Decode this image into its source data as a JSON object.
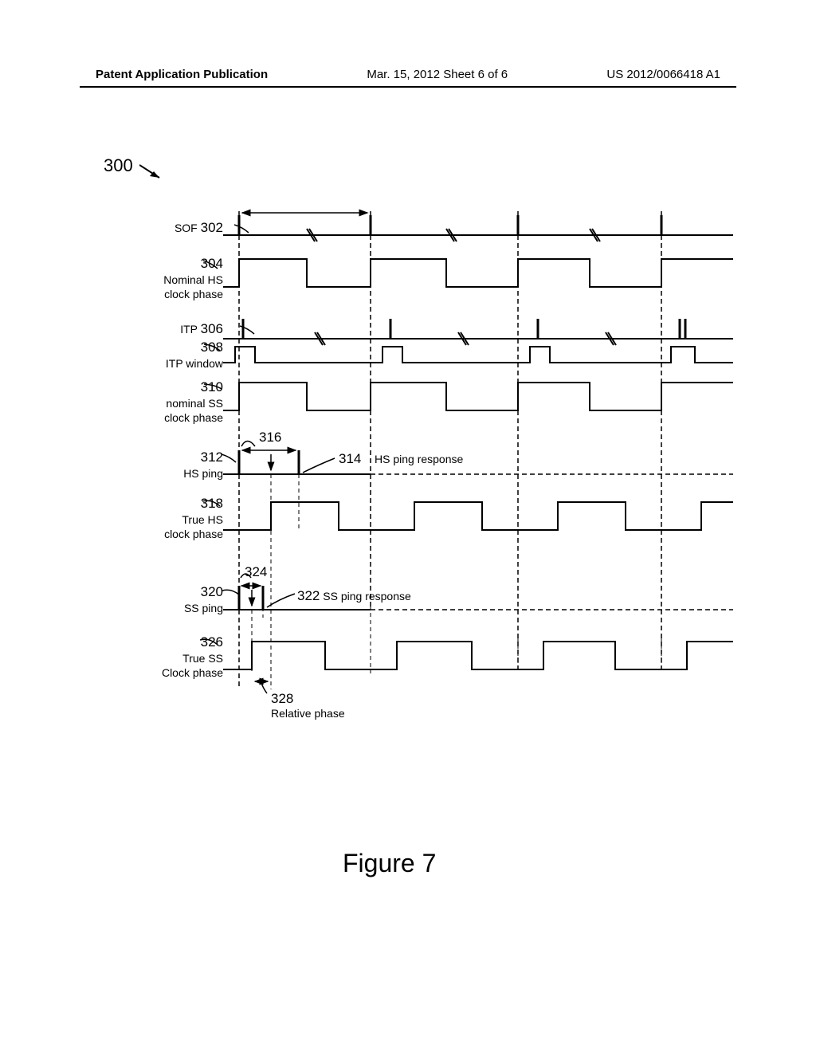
{
  "header": {
    "left": "Patent Application Publication",
    "center": "Mar. 15, 2012 Sheet 6 of 6",
    "right": "US 2012/0066418 A1"
  },
  "diagram": {
    "ref_300": "300",
    "labels": {
      "sof": {
        "ref": "302",
        "text": "SOF"
      },
      "nominal_hs": {
        "ref": "304",
        "text1": "Nominal HS",
        "text2": "clock phase"
      },
      "itp": {
        "ref": "306",
        "text": "ITP"
      },
      "itp_window": {
        "ref": "308",
        "text": "ITP window"
      },
      "nominal_ss": {
        "ref": "310",
        "text1": "nominal SS",
        "text2": "clock phase"
      },
      "hs_ping": {
        "ref": "312",
        "text": "HS ping"
      },
      "hs_ping_response": {
        "ref": "314",
        "text": "HS ping response"
      },
      "hs_rtt": {
        "ref": "316"
      },
      "true_hs": {
        "ref": "318",
        "text1": "True HS",
        "text2": "clock phase"
      },
      "ss_ping": {
        "ref": "320",
        "text": "SS ping"
      },
      "ss_ping_response": {
        "ref": "322",
        "text": "SS ping response"
      },
      "ss_rtt": {
        "ref": "324"
      },
      "true_ss": {
        "ref": "326",
        "text1": "True SS",
        "text2": "Clock phase"
      },
      "relative_phase": {
        "ref": "328",
        "text": "Relative phase"
      }
    }
  },
  "figure_caption": "Figure 7"
}
